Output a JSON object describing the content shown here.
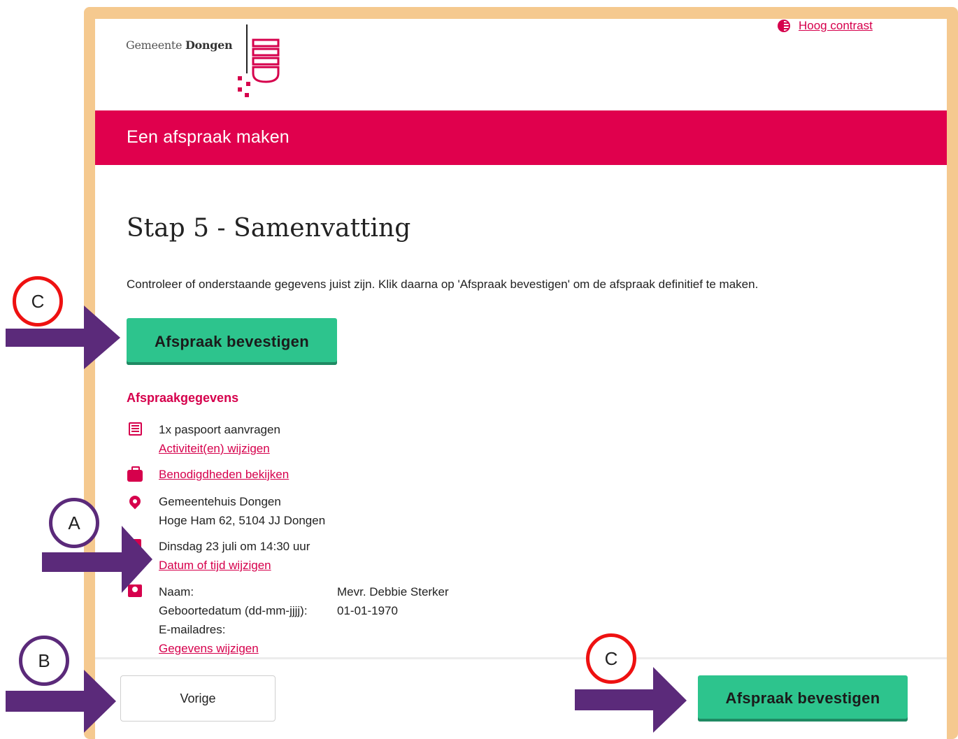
{
  "header": {
    "logo_text_light": "Gemeente ",
    "logo_text_bold": "Dongen",
    "contrast_link": "Hoog contrast"
  },
  "banner": {
    "title": "Een afspraak maken"
  },
  "main": {
    "step_title": "Stap 5 - Samenvatting",
    "intro": "Controleer of onderstaande gegevens juist zijn. Klik daarna op 'Afspraak bevestigen' om de afspraak definitief te maken.",
    "confirm_button": "Afspraak bevestigen",
    "section_title": "Afspraakgegevens",
    "activity": "1x paspoort aanvragen",
    "activity_link": "Activiteit(en) wijzigen",
    "requirements_link": "Benodigdheden bekijken",
    "location_name": "Gemeentehuis Dongen",
    "location_address": "Hoge Ham 62, 5104 JJ Dongen",
    "datetime": "Dinsdag 23 juli om 14:30 uur",
    "datetime_link": "Datum of tijd wijzigen",
    "personal": {
      "name_label": "Naam:",
      "name_value": "Mevr. Debbie Sterker",
      "dob_label": "Geboortedatum (dd-mm-jjjj):",
      "dob_value": "01-01-1970",
      "email_label": "E-mailadres:",
      "edit_link": "Gegevens wijzigen"
    }
  },
  "footer": {
    "prev_button": "Vorige",
    "confirm_button": "Afspraak bevestigen"
  },
  "annotations": {
    "label_c_top": "C",
    "label_a": "A",
    "label_b": "B",
    "label_c_bottom": "C"
  },
  "colors": {
    "brand": "#e0004d",
    "link": "#d6004c",
    "primary_button": "#2dc48d",
    "frame": "#f5c98f",
    "annotation_arrow": "#5b2a7a",
    "annotation_circle_red": "#e11111"
  }
}
